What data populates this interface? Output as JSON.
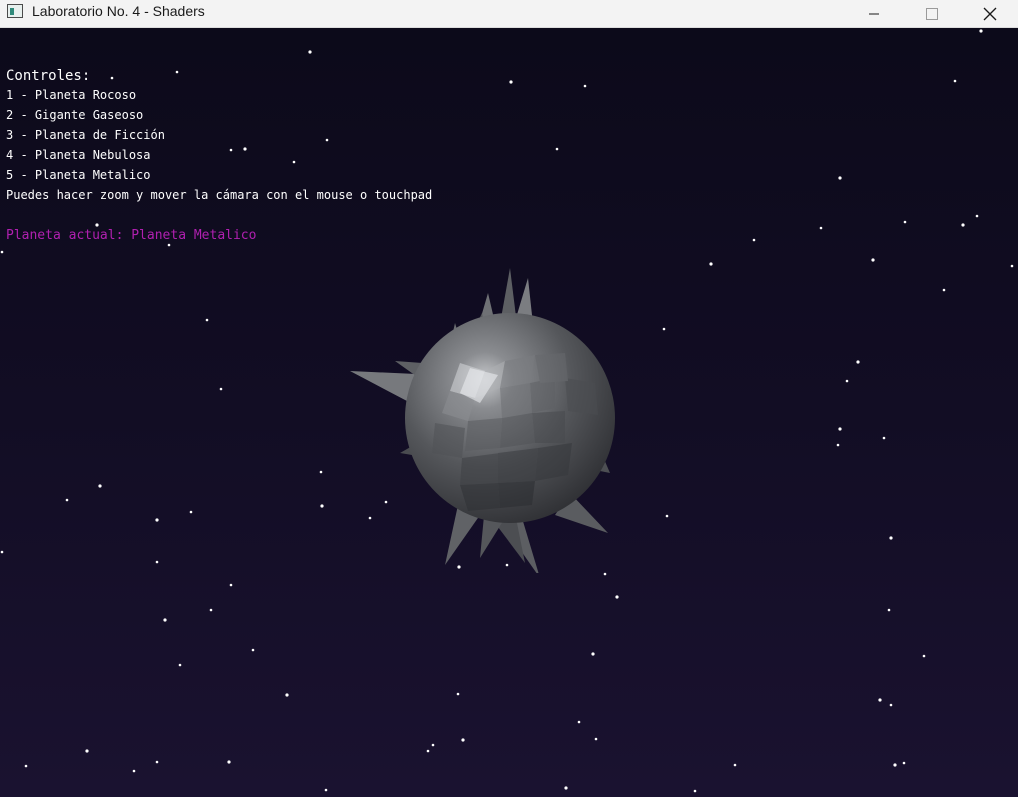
{
  "window": {
    "title": "Laboratorio No. 4 - Shaders",
    "icon": "app-window-icon",
    "controls": {
      "minimize": "minimize-icon",
      "maximize": "maximize-icon",
      "close": "close-icon"
    }
  },
  "hud": {
    "heading": "Controles:",
    "lines": [
      "1 - Planeta Rocoso",
      "2 - Gigante Gaseoso",
      "3 - Planeta de Ficción",
      "4 - Planeta Nebulosa",
      "5 - Planeta Metalico",
      "Puedes hacer zoom y mover la cámara con el mouse o touchpad"
    ],
    "current_label": "Planeta actual:",
    "current_value": "Planeta Metalico"
  },
  "colors": {
    "background_top": "#0c0a1a",
    "background_bottom": "#1a1230",
    "hud_text": "#ffffff",
    "current_planet_text": "#b020b0",
    "planet_base": "#5a5c5f"
  }
}
